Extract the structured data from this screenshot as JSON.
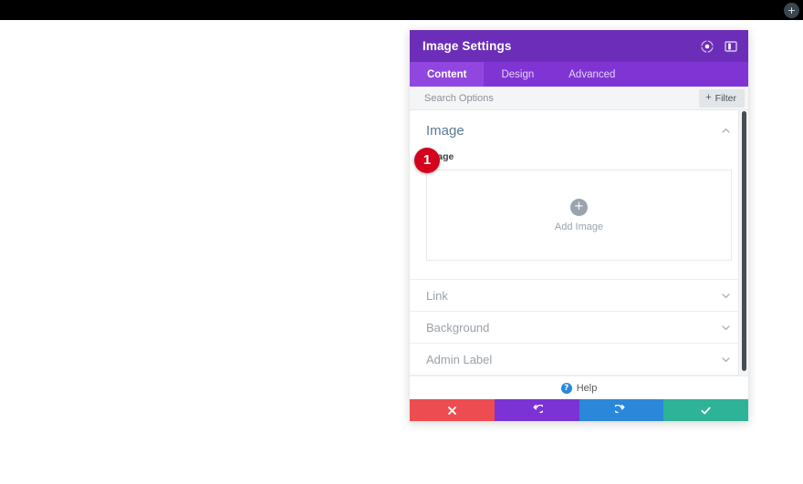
{
  "admin_bar": {
    "add_icon": "plus-circle-icon",
    "add_label": "+"
  },
  "modal": {
    "title": "Image Settings",
    "header_icons": [
      {
        "name": "fullscreen-toggle-icon"
      },
      {
        "name": "panel-layout-icon"
      }
    ],
    "tabs": [
      {
        "label": "Content",
        "active": true
      },
      {
        "label": "Design",
        "active": false
      },
      {
        "label": "Advanced",
        "active": false
      }
    ],
    "search": {
      "placeholder": "Search Options",
      "value": ""
    },
    "filter": {
      "label": "Filter",
      "plus": "+"
    },
    "sections": [
      {
        "title": "Image",
        "open": true,
        "chevron": "chevron-up-icon",
        "field_label": "Image",
        "upload": {
          "plus": "+",
          "label": "Add Image"
        }
      },
      {
        "title": "Link",
        "open": false,
        "chevron": "chevron-down-icon"
      },
      {
        "title": "Background",
        "open": false,
        "chevron": "chevron-down-icon"
      },
      {
        "title": "Admin Label",
        "open": false,
        "chevron": "chevron-down-icon"
      }
    ],
    "help": {
      "icon_label": "?",
      "label": "Help"
    },
    "actions": [
      {
        "name": "cancel-button",
        "icon": "close-x-icon",
        "color": "#ed4c50"
      },
      {
        "name": "undo-button",
        "icon": "undo-icon",
        "color": "#7b33d6"
      },
      {
        "name": "redo-button",
        "icon": "redo-icon",
        "color": "#2b87da"
      },
      {
        "name": "save-button",
        "icon": "checkmark-icon",
        "color": "#2eb398"
      }
    ]
  },
  "annotation": {
    "badge_number": "1"
  },
  "colors": {
    "header_purple": "#6c2eb9",
    "tabbar_purple": "#8034d4",
    "tab_active_purple": "#9246e0",
    "section_title_blue": "#5b7a95",
    "badge_red": "#d4021d"
  }
}
